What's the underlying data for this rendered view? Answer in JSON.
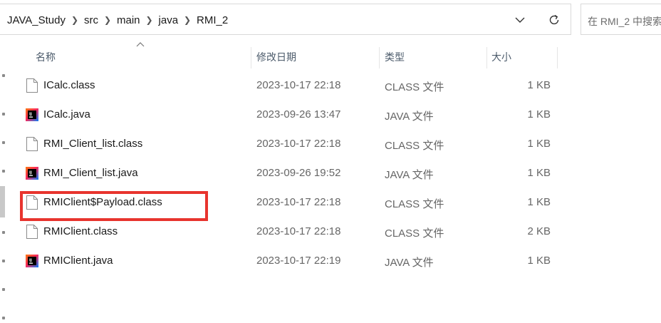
{
  "breadcrumb": [
    "JAVA_Study",
    "src",
    "main",
    "java",
    "RMI_2"
  ],
  "search": {
    "placeholder": "在 RMI_2 中搜索"
  },
  "columns": {
    "name": "名称",
    "modified": "修改日期",
    "type": "类型",
    "size": "大小"
  },
  "files": [
    {
      "name": "ICalc.class",
      "modified": "2023-10-17 22:18",
      "type": "CLASS 文件",
      "size": "1 KB",
      "icon": "class-file-icon"
    },
    {
      "name": "ICalc.java",
      "modified": "2023-09-26 13:47",
      "type": "JAVA 文件",
      "size": "1 KB",
      "icon": "intellij-java-file-icon"
    },
    {
      "name": "RMI_Client_list.class",
      "modified": "2023-10-17 22:18",
      "type": "CLASS 文件",
      "size": "1 KB",
      "icon": "class-file-icon"
    },
    {
      "name": "RMI_Client_list.java",
      "modified": "2023-09-26 19:52",
      "type": "JAVA 文件",
      "size": "1 KB",
      "icon": "intellij-java-file-icon"
    },
    {
      "name": "RMIClient$Payload.class",
      "modified": "2023-10-17 22:18",
      "type": "CLASS 文件",
      "size": "1 KB",
      "icon": "class-file-icon"
    },
    {
      "name": "RMIClient.class",
      "modified": "2023-10-17 22:18",
      "type": "CLASS 文件",
      "size": "2 KB",
      "icon": "class-file-icon"
    },
    {
      "name": "RMIClient.java",
      "modified": "2023-10-17 22:19",
      "type": "JAVA 文件",
      "size": "1 KB",
      "icon": "intellij-java-file-icon"
    }
  ],
  "annotation": {
    "highlight_color": "#e8342e",
    "highlighted_file": "RMIClient$Payload.class"
  }
}
